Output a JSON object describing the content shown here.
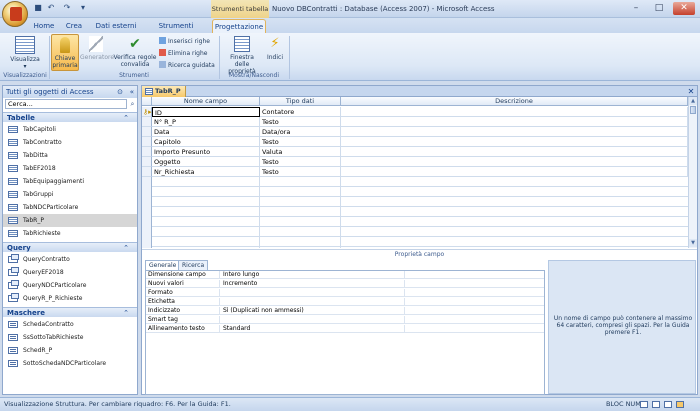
{
  "window": {
    "title": "Nuovo DBContratti : Database (Access 2007) - Microsoft Access",
    "context_tools_label": "Strumenti tabella"
  },
  "quick_access": [
    "save",
    "undo",
    "redo",
    "customize"
  ],
  "tabs": [
    "Home",
    "Crea",
    "Dati esterni",
    "Strumenti database",
    "Progettazione"
  ],
  "active_tab": "Progettazione",
  "ribbon": {
    "groups": {
      "visualizzazioni": "Visualizzazioni",
      "strumenti": "Strumenti",
      "mostra": "Mostra/Nascondi"
    },
    "buttons": {
      "visualizza": "Visualizza",
      "chiave_primaria_1": "Chiave",
      "chiave_primaria_2": "primaria",
      "generatore": "Generatore",
      "verifica_1": "Verifica regole",
      "verifica_2": "convalida",
      "inserisci_righe": "Inserisci righe",
      "elimina_righe": "Elimina righe",
      "ricerca_guidata": "Ricerca guidata",
      "finestra_1": "Finestra delle",
      "finestra_2": "proprietà",
      "indici": "Indici"
    }
  },
  "nav": {
    "header": "Tutti gli oggetti di Access",
    "search_value": "Cerca...",
    "groups": [
      {
        "label": "Tabelle",
        "items": [
          "TabCapitoli",
          "TabContratto",
          "TabDitta",
          "TabEF2018",
          "TabEquipaggiamenti",
          "TabGruppi",
          "TabNDCParticolare",
          "TabR_P",
          "TabRichieste"
        ]
      },
      {
        "label": "Query",
        "items": [
          "QueryContratto",
          "QueryEF2018",
          "QueryNDCParticolare",
          "QueryR_P_Richieste"
        ]
      },
      {
        "label": "Maschere",
        "items": [
          "SchedaContratto",
          "SsSottoTabRichieste",
          "SchedR_P",
          "SottoSchedaNDCParticolare"
        ]
      }
    ],
    "selected_item": "TabR_P"
  },
  "document": {
    "tab_label": "TabR_P",
    "columns": [
      "Nome campo",
      "Tipo dati",
      "Descrizione"
    ],
    "rows": [
      {
        "name": "ID",
        "type": "Contatore"
      },
      {
        "name": "N° R_P",
        "type": "Testo"
      },
      {
        "name": "Data",
        "type": "Data/ora"
      },
      {
        "name": "Capitolo",
        "type": "Testo"
      },
      {
        "name": "Importo Presunto",
        "type": "Valuta"
      },
      {
        "name": "Oggetto",
        "type": "Testo"
      },
      {
        "name": "Nr_Richiesta",
        "type": "Testo"
      }
    ]
  },
  "properties": {
    "title": "Proprietà campo",
    "tabs": [
      "Generale",
      "Ricerca"
    ],
    "rows": [
      {
        "label": "Dimensione campo",
        "value": "Intero lungo"
      },
      {
        "label": "Nuovi valori",
        "value": "Incremento"
      },
      {
        "label": "Formato",
        "value": ""
      },
      {
        "label": "Etichetta",
        "value": ""
      },
      {
        "label": "Indicizzato",
        "value": "Sì (Duplicati non ammessi)"
      },
      {
        "label": "Smart tag",
        "value": ""
      },
      {
        "label": "Allineamento testo",
        "value": "Standard"
      }
    ],
    "help_text": "Un nome di campo può contenere al massimo 64 caratteri, compresi gli spazi. Per la Guida premere F1."
  },
  "status": {
    "text": "Visualizzazione Struttura. Per cambiare riquadro: F6. Per la Guida: F1.",
    "num_lock": "BLOC NUM"
  }
}
